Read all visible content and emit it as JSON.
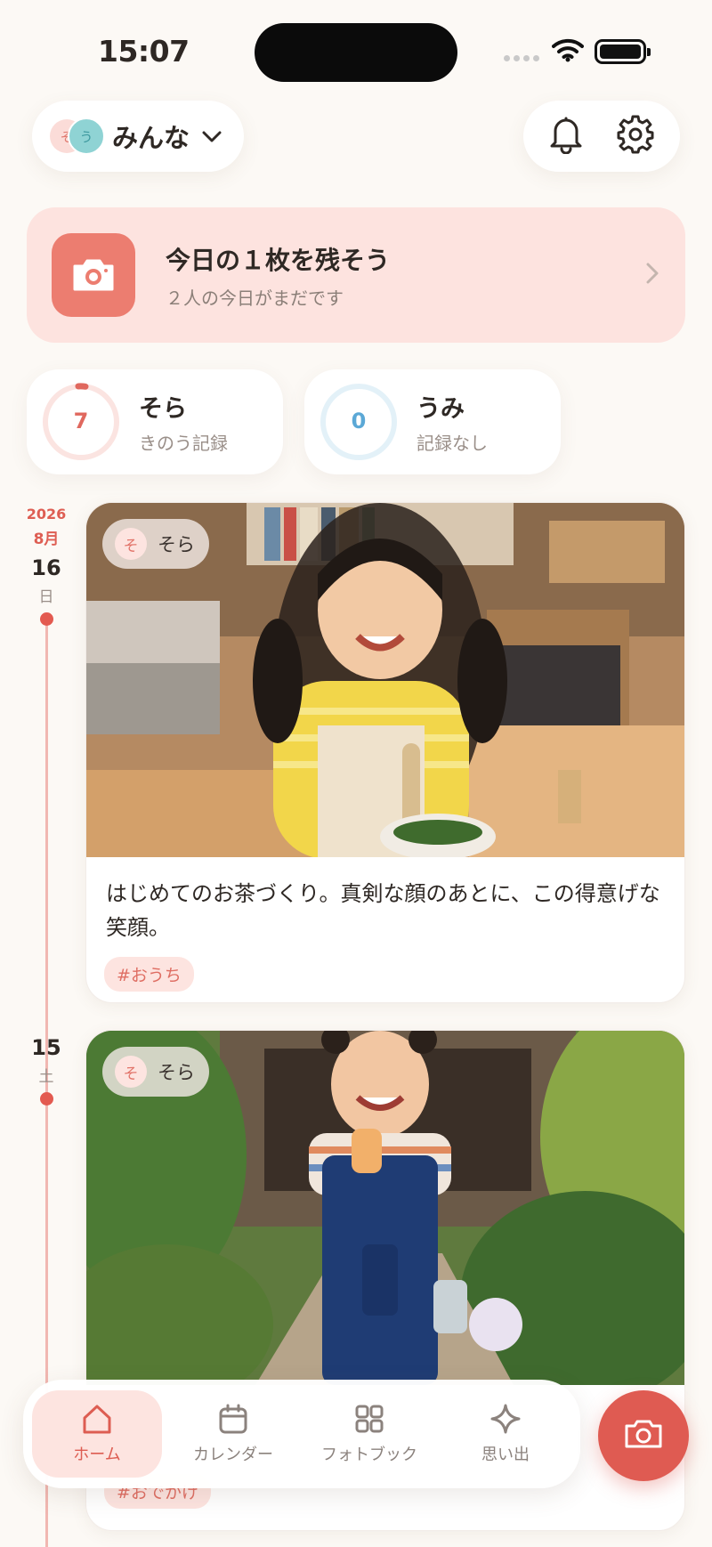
{
  "status_bar": {
    "time": "15:07"
  },
  "header": {
    "avatars": [
      "そ",
      "う"
    ],
    "selector_label": "みんな"
  },
  "banner": {
    "title": "今日の１枚を残そう",
    "subtitle": "２人の今日がまだです"
  },
  "children": [
    {
      "name": "そら",
      "count": "7",
      "note": "きのう記録",
      "ring_color": "#e0685e",
      "ring_progress": 0.03
    },
    {
      "name": "うみ",
      "count": "0",
      "note": "記録なし",
      "ring_color": "#5ba8d6",
      "ring_progress": 0
    }
  ],
  "timeline": [
    {
      "year": "2026",
      "month": "8月",
      "day": "16",
      "weekday": "日",
      "child_initial": "そ",
      "child_name": "そら",
      "caption": "はじめてのお茶づくり。真剣な顔のあとに、この得意げな笑顔。",
      "hashtag": "#おうち"
    },
    {
      "day": "15",
      "weekday": "土",
      "child_initial": "そ",
      "child_name": "そら",
      "hashtag": "#おでかけ"
    }
  ],
  "nav": {
    "items": [
      {
        "label": "ホーム",
        "icon": "home-icon",
        "active": true
      },
      {
        "label": "カレンダー",
        "icon": "calendar-icon"
      },
      {
        "label": "フォトブック",
        "icon": "grid-icon"
      },
      {
        "label": "思い出",
        "icon": "sparkle-icon"
      }
    ]
  },
  "colors": {
    "accent": "#df5b52",
    "background": "#fcf9f5",
    "banner": "#fde3df"
  }
}
